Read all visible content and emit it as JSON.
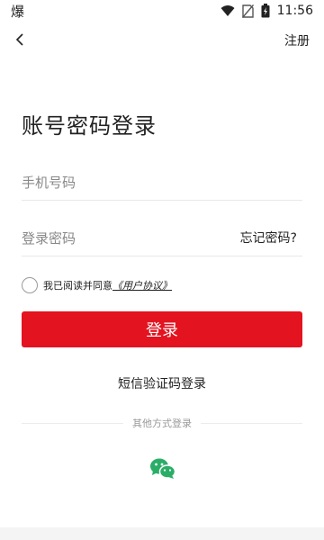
{
  "status_bar": {
    "left_glyph": "爆",
    "time": "11:56"
  },
  "nav": {
    "register_label": "注册"
  },
  "title": "账号密码登录",
  "form": {
    "phone_placeholder": "手机号码",
    "password_placeholder": "登录密码",
    "forgot_label": "忘记密码?"
  },
  "agreement": {
    "text": "我已阅读并同意",
    "link": "《用户协议》"
  },
  "login_button": "登录",
  "sms_login": "短信验证码登录",
  "other_login": "其他方式登录",
  "colors": {
    "accent": "#e3131f",
    "wechat": "#2aae67"
  }
}
